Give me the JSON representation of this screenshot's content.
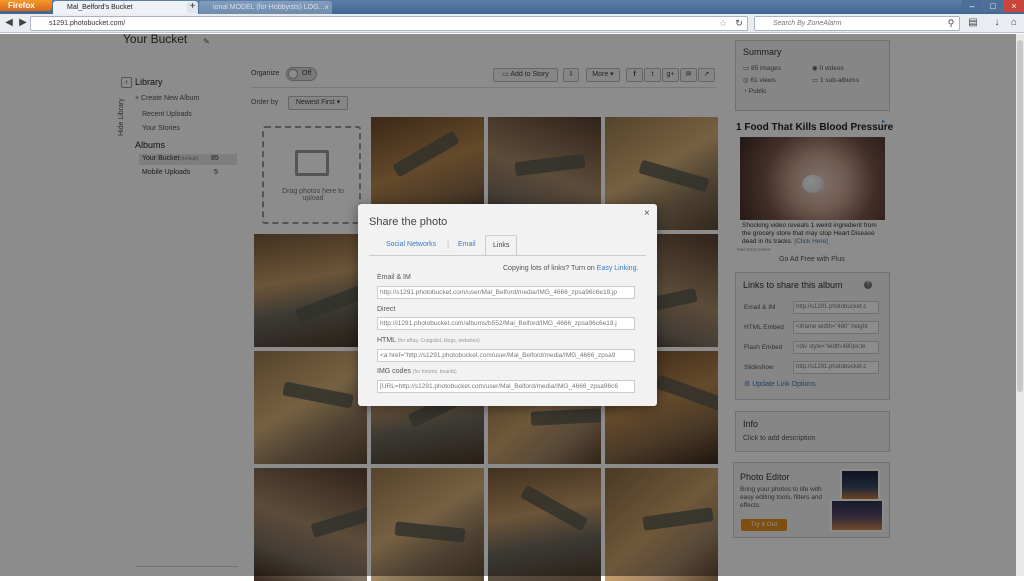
{
  "browser": {
    "menu_button": "Firefox",
    "tabs": [
      {
        "label": "Mal_Belford's Bucket"
      },
      {
        "label": "ional MODEL (for Hobbyists) LOG..."
      }
    ],
    "new_tab": "+",
    "url": "s1291.photobucket.com/",
    "search_placeholder": "Search By ZoneAlarm"
  },
  "header": {
    "title": "Your Bucket"
  },
  "toolbar": {
    "organize_label": "Organize",
    "organize_toggle": "Off",
    "add_to_story": "Add to Story",
    "more": "More"
  },
  "sort": {
    "label": "Order by",
    "value": "Newest First"
  },
  "library": {
    "title": "Library",
    "hide_label": "Hide Library",
    "items": [
      "+ Create New Album",
      "Recent Uploads",
      "Your Stories"
    ],
    "albums_title": "Albums",
    "albums": [
      {
        "name": "Your Bucket",
        "tag": "(default)",
        "count": "85"
      },
      {
        "name": "Mobile Uploads",
        "tag": "",
        "count": "5"
      }
    ]
  },
  "upload": {
    "text": "Drag photos here to upload"
  },
  "summary": {
    "title": "Summary",
    "images": "85 images",
    "videos": "0 videos",
    "views": "61 views",
    "subalbums": "1 sub-albums",
    "privacy": "Public"
  },
  "ad": {
    "headline": "1 Food That Kills Blood Pressure",
    "body": "Shocking video reveals 1 weird ingredient from the grocery store that may stop Heart Disease dead in its tracks.",
    "click": "[Click Here]",
    "source": "Mail.RevContent",
    "go_ad_free": "Go Ad Free with Plus"
  },
  "links_panel": {
    "title": "Links to share this album",
    "rows": [
      {
        "label": "Email & IM",
        "value": "http://s1291.photobucket.c"
      },
      {
        "label": "HTML Embed",
        "value": "<iframe width=\"480\" height"
      },
      {
        "label": "Flash Embed",
        "value": "<div style=\"width:480px;te"
      },
      {
        "label": "Slideshow",
        "value": "http://s1291.photobucket.c"
      }
    ],
    "update": "Update Link Options"
  },
  "info": {
    "title": "Info",
    "placeholder": "Click to add description"
  },
  "photo_editor": {
    "title": "Photo Editor",
    "text": "Bring your photos to life with easy editing tools, filters and effects.",
    "button": "Try it Out"
  },
  "modal": {
    "title": "Share the photo",
    "close": "×",
    "tabs": [
      "Social Networks",
      "Email",
      "Links"
    ],
    "active_tab": "Links",
    "hint": "Copying lots of links? Turn on",
    "hint_link": "Easy Linking.",
    "fields": [
      {
        "label": "Email & IM",
        "note": "",
        "value": "http://s1291.photobucket.com/user/Mal_Belford/media/IMG_4666_zpsa96c6e19.jp"
      },
      {
        "label": "Direct",
        "note": "",
        "value": "http://i1291.photobucket.com/albums/b552/Mal_Belford/IMG_4666_zpsa96c6e19.j"
      },
      {
        "label": "HTML",
        "note": "(for eBay, Craigslist, blogs, websites)",
        "value": "<a href=\"http://s1291.photobucket.com/user/Mal_Belford/media/IMG_4666_zpsa9"
      },
      {
        "label": "IMG codes",
        "note": "(for forums, boards)",
        "value": "[URL=http://s1291.photobucket.com/user/Mal_Belford/media/IMG_4666_zpsa96c6"
      }
    ]
  },
  "colors": {
    "accent_blue": "#3a7bbf",
    "button_orange": "#e8911c",
    "firefox_orange": "#e07a22"
  }
}
